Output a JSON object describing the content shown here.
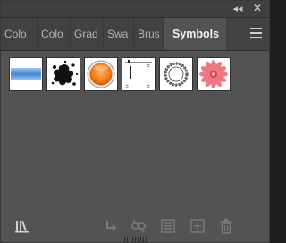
{
  "window": {
    "collapse_glyph": "◂◂",
    "close_glyph": "✕"
  },
  "tabs": [
    {
      "label": "Colo",
      "active": false
    },
    {
      "label": "Colo",
      "active": false
    },
    {
      "label": "Grad",
      "active": false
    },
    {
      "label": "Swa",
      "active": false
    },
    {
      "label": "Brus",
      "active": false
    },
    {
      "label": "Symbols",
      "active": true
    }
  ],
  "menu": {
    "icon": "hamburger-menu-icon"
  },
  "symbols": [
    {
      "name": "blue-banner-symbol"
    },
    {
      "name": "ink-splat-symbol"
    },
    {
      "name": "orange-button-symbol"
    },
    {
      "name": "rectangle-frame-symbol"
    },
    {
      "name": "rope-wreath-symbol"
    },
    {
      "name": "pink-flower-symbol"
    }
  ],
  "bottom_icons": [
    {
      "name": "symbol-libraries-menu-icon",
      "enabled": true
    },
    {
      "name": "place-symbol-instance-icon",
      "enabled": false
    },
    {
      "name": "break-link-icon",
      "enabled": false
    },
    {
      "name": "symbol-options-icon",
      "enabled": false
    },
    {
      "name": "new-symbol-icon",
      "enabled": false
    },
    {
      "name": "delete-symbol-icon",
      "enabled": false
    }
  ],
  "colors": {
    "panel_bg": "#535353",
    "tab_bar_bg": "#424242",
    "active_tab_text": "#f0f0f0",
    "inactive_tab_text": "#b4b4b4"
  }
}
